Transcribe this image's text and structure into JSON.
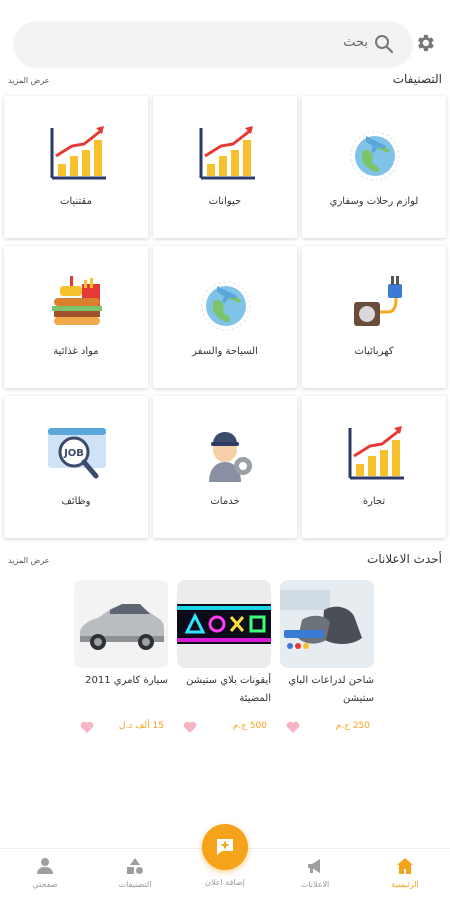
{
  "search": {
    "placeholder": "بحث"
  },
  "categories_section": {
    "title": "التصنيفات",
    "see_more": "عرض المزيد"
  },
  "categories": [
    {
      "label": "لوازم رحلات وسفاري",
      "icon": "globe-plane-icon"
    },
    {
      "label": "حيوانات",
      "icon": "growth-chart-icon"
    },
    {
      "label": "مقتنيات",
      "icon": "growth-chart-icon"
    },
    {
      "label": "كهربائيات",
      "icon": "power-plug-icon"
    },
    {
      "label": "السياحة والسفر",
      "icon": "globe-plane-icon"
    },
    {
      "label": "مواد غذائية",
      "icon": "fast-food-icon"
    },
    {
      "label": "تجارة",
      "icon": "growth-chart-icon"
    },
    {
      "label": "خدمات",
      "icon": "service-worker-icon"
    },
    {
      "label": "وظائف",
      "icon": "job-search-icon"
    }
  ],
  "ads_section": {
    "title": "أحدث الاعلانات",
    "see_more": "عرض المزيد"
  },
  "ads": [
    {
      "title": "شاحن لدراعات الباي ستيشن",
      "price": "250 ج.م",
      "image": "controller-charger-photo"
    },
    {
      "title": "أيقونات بلاي ستيشن المضيئة",
      "price": "500 ج.م",
      "image": "neon-playstation-icons-photo"
    },
    {
      "title": "سيارة كامري 2011",
      "price": "15 ألف د.ل",
      "image": "silver-sedan-photo"
    }
  ],
  "nav": {
    "home": "الرئيسية",
    "ads": "الاعلانات",
    "add_ad": "إضافة اعلان",
    "categories": "التصنيفات",
    "profile": "صفحتي"
  },
  "colors": {
    "accent": "#f5a31a",
    "heart": "#f6b5c3"
  }
}
